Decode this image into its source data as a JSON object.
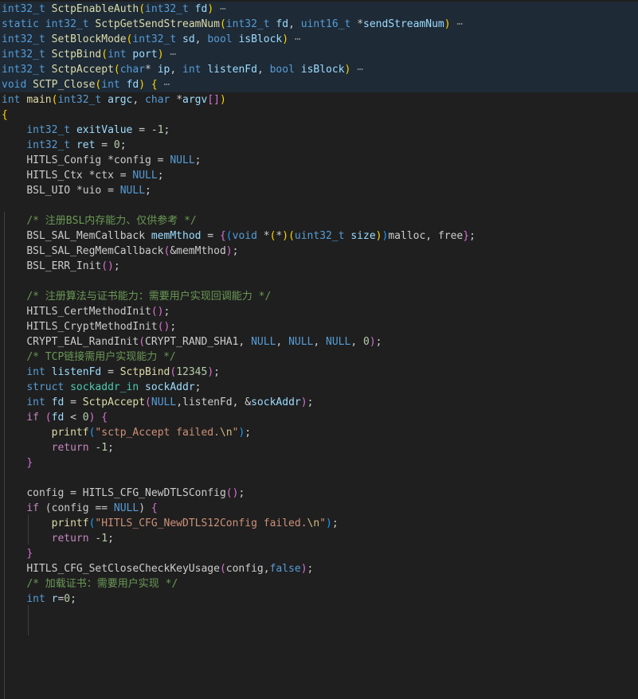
{
  "editor": {
    "lines": [
      {
        "folded": true,
        "tokens": [
          [
            "int32_t ",
            "type"
          ],
          [
            "SctpEnableAuth",
            "fn"
          ],
          [
            "(",
            "b1"
          ],
          [
            "int32_t ",
            "type"
          ],
          [
            "fd",
            "var"
          ],
          [
            ")",
            "b1"
          ],
          [
            " ⋯",
            "ell"
          ]
        ]
      },
      {
        "folded": true,
        "tokens": [
          [
            "static ",
            "type"
          ],
          [
            "int32_t ",
            "type"
          ],
          [
            "SctpGetSendStreamNum",
            "fn"
          ],
          [
            "(",
            "b1"
          ],
          [
            "int32_t ",
            "type"
          ],
          [
            "fd",
            "var"
          ],
          [
            ", ",
            "plain"
          ],
          [
            "uint16_t ",
            "type"
          ],
          [
            "*",
            "plain"
          ],
          [
            "sendStreamNum",
            "var"
          ],
          [
            ")",
            "b1"
          ],
          [
            " ⋯",
            "ell"
          ]
        ]
      },
      {
        "folded": true,
        "tokens": [
          [
            "int32_t ",
            "type"
          ],
          [
            "SetBlockMode",
            "fn"
          ],
          [
            "(",
            "b1"
          ],
          [
            "int32_t ",
            "type"
          ],
          [
            "sd",
            "var"
          ],
          [
            ", ",
            "plain"
          ],
          [
            "bool ",
            "type"
          ],
          [
            "isBlock",
            "var"
          ],
          [
            ")",
            "b1"
          ],
          [
            " ⋯",
            "ell"
          ]
        ]
      },
      {
        "folded": true,
        "tokens": [
          [
            "int32_t ",
            "type"
          ],
          [
            "SctpBind",
            "fn"
          ],
          [
            "(",
            "b1"
          ],
          [
            "int ",
            "type"
          ],
          [
            "port",
            "var"
          ],
          [
            ")",
            "b1"
          ],
          [
            " ⋯",
            "ell"
          ]
        ]
      },
      {
        "folded": true,
        "tokens": [
          [
            "int32_t ",
            "type"
          ],
          [
            "SctpAccept",
            "fn"
          ],
          [
            "(",
            "b1"
          ],
          [
            "char",
            "type"
          ],
          [
            "* ",
            "plain"
          ],
          [
            "ip",
            "var"
          ],
          [
            ", ",
            "plain"
          ],
          [
            "int ",
            "type"
          ],
          [
            "listenFd",
            "var"
          ],
          [
            ", ",
            "plain"
          ],
          [
            "bool ",
            "type"
          ],
          [
            "isBlock",
            "var"
          ],
          [
            ")",
            "b1"
          ],
          [
            " ⋯",
            "ell"
          ]
        ]
      },
      {
        "folded": true,
        "tokens": [
          [
            "void ",
            "type"
          ],
          [
            "SCTP_Close",
            "fn"
          ],
          [
            "(",
            "b1"
          ],
          [
            "int ",
            "type"
          ],
          [
            "fd",
            "var"
          ],
          [
            ")",
            "b1"
          ],
          [
            " ",
            "plain"
          ],
          [
            "{",
            "b1"
          ],
          [
            " ⋯",
            "ell"
          ]
        ]
      },
      {
        "folded": false,
        "tokens": [
          [
            "int ",
            "type"
          ],
          [
            "main",
            "fn"
          ],
          [
            "(",
            "b1"
          ],
          [
            "int32_t ",
            "type"
          ],
          [
            "argc",
            "var"
          ],
          [
            ", ",
            "plain"
          ],
          [
            "char ",
            "type"
          ],
          [
            "*",
            "plain"
          ],
          [
            "argv",
            "var"
          ],
          [
            "[]",
            "b2"
          ],
          [
            ")",
            "b1"
          ]
        ]
      },
      {
        "folded": false,
        "tokens": [
          [
            "{",
            "b1"
          ]
        ]
      },
      {
        "folded": false,
        "tokens": [
          [
            "    ",
            "plain"
          ],
          [
            "int32_t ",
            "type"
          ],
          [
            "exitValue",
            "var"
          ],
          [
            " = -",
            "plain"
          ],
          [
            "1",
            "num"
          ],
          [
            ";",
            "plain"
          ]
        ]
      },
      {
        "folded": false,
        "tokens": [
          [
            "    ",
            "plain"
          ],
          [
            "int32_t ",
            "type"
          ],
          [
            "ret",
            "var"
          ],
          [
            " = ",
            "plain"
          ],
          [
            "0",
            "num"
          ],
          [
            ";",
            "plain"
          ]
        ]
      },
      {
        "folded": false,
        "tokens": [
          [
            "    ",
            "plain"
          ],
          [
            "HITLS_Config ",
            "plain"
          ],
          [
            "*config = ",
            "plain"
          ],
          [
            "NULL",
            "type"
          ],
          [
            ";",
            "plain"
          ]
        ]
      },
      {
        "folded": false,
        "tokens": [
          [
            "    ",
            "plain"
          ],
          [
            "HITLS_Ctx ",
            "plain"
          ],
          [
            "*ctx = ",
            "plain"
          ],
          [
            "NULL",
            "type"
          ],
          [
            ";",
            "plain"
          ]
        ]
      },
      {
        "folded": false,
        "tokens": [
          [
            "    ",
            "plain"
          ],
          [
            "BSL_UIO ",
            "plain"
          ],
          [
            "*uio = ",
            "plain"
          ],
          [
            "NULL",
            "type"
          ],
          [
            ";",
            "plain"
          ]
        ]
      },
      {
        "folded": false,
        "tokens": [
          [
            "",
            "plain"
          ]
        ]
      },
      {
        "folded": false,
        "tokens": [
          [
            "    ",
            "plain"
          ],
          [
            "/* 注册BSL内存能力、仅供参考 */",
            "cmt"
          ]
        ]
      },
      {
        "folded": false,
        "tokens": [
          [
            "    ",
            "plain"
          ],
          [
            "BSL_SAL_MemCallback ",
            "plain"
          ],
          [
            "memMthod",
            "var"
          ],
          [
            " = ",
            "plain"
          ],
          [
            "{",
            "b2"
          ],
          [
            "(",
            "b3"
          ],
          [
            "void ",
            "type"
          ],
          [
            "*",
            "plain"
          ],
          [
            "(",
            "b1"
          ],
          [
            "*",
            "plain"
          ],
          [
            ")",
            "b1"
          ],
          [
            "(",
            "b1"
          ],
          [
            "uint32_t ",
            "type"
          ],
          [
            "size",
            "var"
          ],
          [
            ")",
            "b1"
          ],
          [
            ")",
            "b3"
          ],
          [
            "malloc, free",
            "plain"
          ],
          [
            "}",
            "b2"
          ],
          [
            ";",
            "plain"
          ]
        ]
      },
      {
        "folded": false,
        "tokens": [
          [
            "    ",
            "plain"
          ],
          [
            "BSL_SAL_RegMemCallback",
            "plain"
          ],
          [
            "(",
            "b2"
          ],
          [
            "&memMthod",
            "plain"
          ],
          [
            ")",
            "b2"
          ],
          [
            ";",
            "plain"
          ]
        ]
      },
      {
        "folded": false,
        "tokens": [
          [
            "    ",
            "plain"
          ],
          [
            "BSL_ERR_Init",
            "plain"
          ],
          [
            "()",
            "b2"
          ],
          [
            ";",
            "plain"
          ]
        ]
      },
      {
        "folded": false,
        "tokens": [
          [
            "",
            "plain"
          ]
        ]
      },
      {
        "folded": false,
        "tokens": [
          [
            "    ",
            "plain"
          ],
          [
            "/* 注册算法与证书能力：需要用户实现回调能力 */",
            "cmt"
          ]
        ]
      },
      {
        "folded": false,
        "tokens": [
          [
            "    ",
            "plain"
          ],
          [
            "HITLS_CertMethodInit",
            "plain"
          ],
          [
            "()",
            "b2"
          ],
          [
            ";",
            "plain"
          ]
        ]
      },
      {
        "folded": false,
        "tokens": [
          [
            "    ",
            "plain"
          ],
          [
            "HITLS_CryptMethodInit",
            "plain"
          ],
          [
            "()",
            "b2"
          ],
          [
            ";",
            "plain"
          ]
        ]
      },
      {
        "folded": false,
        "tokens": [
          [
            "    ",
            "plain"
          ],
          [
            "CRYPT_EAL_RandInit",
            "plain"
          ],
          [
            "(",
            "b2"
          ],
          [
            "CRYPT_RAND_SHA1, ",
            "plain"
          ],
          [
            "NULL",
            "type"
          ],
          [
            ", ",
            "plain"
          ],
          [
            "NULL",
            "type"
          ],
          [
            ", ",
            "plain"
          ],
          [
            "NULL",
            "type"
          ],
          [
            ", ",
            "plain"
          ],
          [
            "0",
            "num"
          ],
          [
            ")",
            "b2"
          ],
          [
            ";",
            "plain"
          ]
        ]
      },
      {
        "folded": false,
        "tokens": [
          [
            "    ",
            "plain"
          ],
          [
            "/* TCP链接需用户实现能力 */",
            "cmt"
          ]
        ]
      },
      {
        "folded": false,
        "tokens": [
          [
            "    ",
            "plain"
          ],
          [
            "int ",
            "type"
          ],
          [
            "listenFd",
            "var"
          ],
          [
            " = ",
            "plain"
          ],
          [
            "SctpBind",
            "fn"
          ],
          [
            "(",
            "b2"
          ],
          [
            "12345",
            "num"
          ],
          [
            ")",
            "b2"
          ],
          [
            ";",
            "plain"
          ]
        ]
      },
      {
        "folded": false,
        "tokens": [
          [
            "    ",
            "plain"
          ],
          [
            "struct ",
            "type"
          ],
          [
            "sockaddr_in ",
            "cls"
          ],
          [
            "sockAddr",
            "var"
          ],
          [
            ";",
            "plain"
          ]
        ]
      },
      {
        "folded": false,
        "tokens": [
          [
            "    ",
            "plain"
          ],
          [
            "int ",
            "type"
          ],
          [
            "fd",
            "var"
          ],
          [
            " = ",
            "plain"
          ],
          [
            "SctpAccept",
            "fn"
          ],
          [
            "(",
            "b2"
          ],
          [
            "NULL",
            "type"
          ],
          [
            ",listenFd, &",
            "plain"
          ],
          [
            "sockAddr",
            "var"
          ],
          [
            ")",
            "b2"
          ],
          [
            ";",
            "plain"
          ]
        ]
      },
      {
        "folded": false,
        "tokens": [
          [
            "    ",
            "plain"
          ],
          [
            "if ",
            "kw"
          ],
          [
            "(",
            "b2"
          ],
          [
            "fd ",
            "var"
          ],
          [
            "< ",
            "plain"
          ],
          [
            "0",
            "num"
          ],
          [
            ")",
            "b2"
          ],
          [
            " ",
            "plain"
          ],
          [
            "{",
            "b2"
          ]
        ]
      },
      {
        "folded": false,
        "tokens": [
          [
            "        ",
            "plain"
          ],
          [
            "printf",
            "fn"
          ],
          [
            "(",
            "b3"
          ],
          [
            "\"sctp_Accept failed.",
            "str"
          ],
          [
            "\\n",
            "esc"
          ],
          [
            "\"",
            "str"
          ],
          [
            ")",
            "b3"
          ],
          [
            ";",
            "plain"
          ]
        ]
      },
      {
        "folded": false,
        "tokens": [
          [
            "        ",
            "plain"
          ],
          [
            "return ",
            "kw"
          ],
          [
            "-",
            "plain"
          ],
          [
            "1",
            "num"
          ],
          [
            ";",
            "plain"
          ]
        ]
      },
      {
        "folded": false,
        "tokens": [
          [
            "    ",
            "plain"
          ],
          [
            "}",
            "b2"
          ]
        ]
      },
      {
        "folded": false,
        "tokens": [
          [
            "",
            "plain"
          ]
        ]
      },
      {
        "folded": false,
        "tokens": [
          [
            "    ",
            "plain"
          ],
          [
            "config = ",
            "plain"
          ],
          [
            "HITLS_CFG_NewDTLSConfig",
            "plain"
          ],
          [
            "()",
            "b2"
          ],
          [
            ";",
            "plain"
          ]
        ]
      },
      {
        "folded": false,
        "tokens": [
          [
            "    ",
            "plain"
          ],
          [
            "if ",
            "kw"
          ],
          [
            "(config == ",
            "plain"
          ],
          [
            "NULL",
            "type"
          ],
          [
            ") ",
            "plain"
          ],
          [
            "{",
            "b2"
          ]
        ]
      },
      {
        "folded": false,
        "tokens": [
          [
            "        ",
            "plain"
          ],
          [
            "printf",
            "fn"
          ],
          [
            "(",
            "b3"
          ],
          [
            "\"HITLS_CFG_NewDTLS12Config failed.",
            "str"
          ],
          [
            "\\n",
            "esc"
          ],
          [
            "\"",
            "str"
          ],
          [
            ")",
            "b3"
          ],
          [
            ";",
            "plain"
          ]
        ]
      },
      {
        "folded": false,
        "tokens": [
          [
            "        ",
            "plain"
          ],
          [
            "return ",
            "kw"
          ],
          [
            "-",
            "plain"
          ],
          [
            "1",
            "num"
          ],
          [
            ";",
            "plain"
          ]
        ]
      },
      {
        "folded": false,
        "tokens": [
          [
            "    ",
            "plain"
          ],
          [
            "}",
            "b2"
          ]
        ]
      },
      {
        "folded": false,
        "tokens": [
          [
            "    ",
            "plain"
          ],
          [
            "HITLS_CFG_SetCloseCheckKeyUsage",
            "plain"
          ],
          [
            "(",
            "b2"
          ],
          [
            "config,",
            "plain"
          ],
          [
            "false",
            "type"
          ],
          [
            ")",
            "b2"
          ],
          [
            ";",
            "plain"
          ]
        ]
      },
      {
        "folded": false,
        "tokens": [
          [
            "    ",
            "plain"
          ],
          [
            "/* 加载证书：需要用户实现 */",
            "cmt"
          ]
        ]
      },
      {
        "folded": false,
        "tokens": [
          [
            "    ",
            "plain"
          ],
          [
            "int ",
            "type"
          ],
          [
            "r",
            "var"
          ],
          [
            "=",
            "plain"
          ],
          [
            "0",
            "num"
          ],
          [
            ";",
            "plain"
          ]
        ]
      }
    ]
  }
}
